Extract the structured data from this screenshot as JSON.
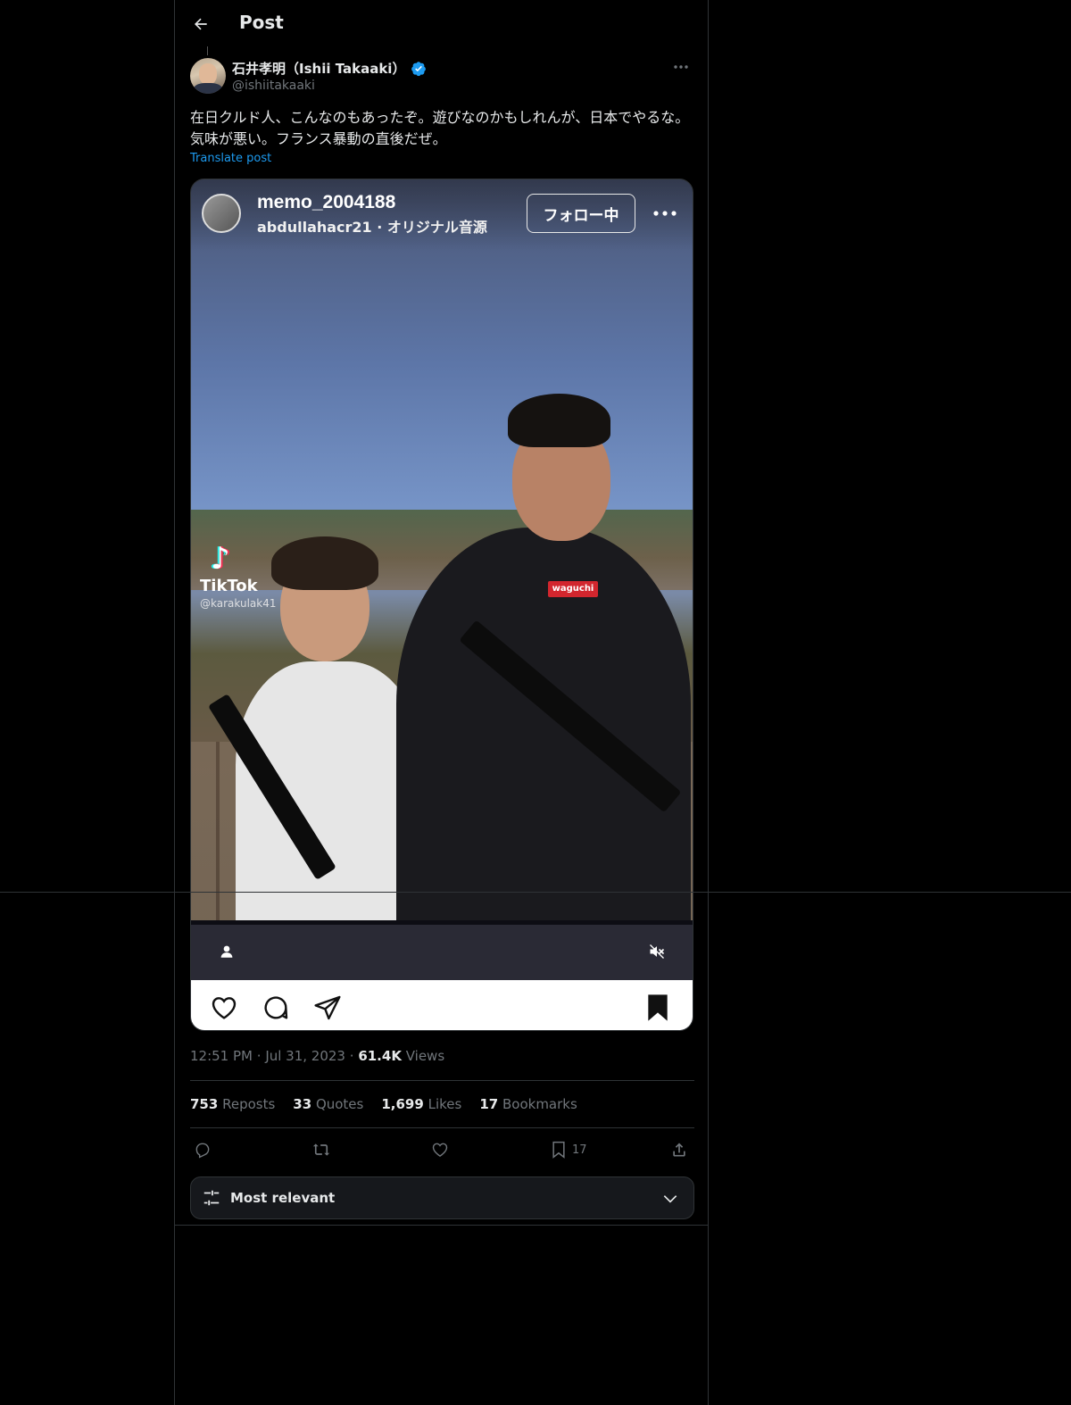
{
  "header": {
    "title": "Post"
  },
  "author": {
    "name": "石井孝明（Ishii Takaaki）",
    "handle": "@ishiitakaaki",
    "verified": true
  },
  "post": {
    "text": "在日クルド人、こんなのもあったぞ。遊びなのかもしれんが、日本でやるな。気味が悪い。フランス暴動の直後だぜ。",
    "translate_label": "Translate post",
    "time": "12:51 PM",
    "date": "Jul 31, 2023",
    "views_count": "61.4K",
    "views_label": "Views"
  },
  "media": {
    "ig_username": "memo_2004188",
    "ig_subtitle": "abdullahacr21 · オリジナル音源",
    "follow_label": "フォロー中",
    "tiktok_brand": "TikTok",
    "tiktok_user": "@karakulak41",
    "shirt_logo": "waguchi"
  },
  "stats": {
    "reposts_count": "753",
    "reposts_label": "Reposts",
    "quotes_count": "33",
    "quotes_label": "Quotes",
    "likes_count": "1,699",
    "likes_label": "Likes",
    "bookmarks_count": "17",
    "bookmarks_label": "Bookmarks"
  },
  "action_bar": {
    "bookmark_count": "17"
  },
  "sort": {
    "label": "Most relevant"
  },
  "colors": {
    "accent": "#1d9bf0",
    "background": "#000000",
    "muted": "#71767b",
    "text": "#e7e9ea"
  }
}
